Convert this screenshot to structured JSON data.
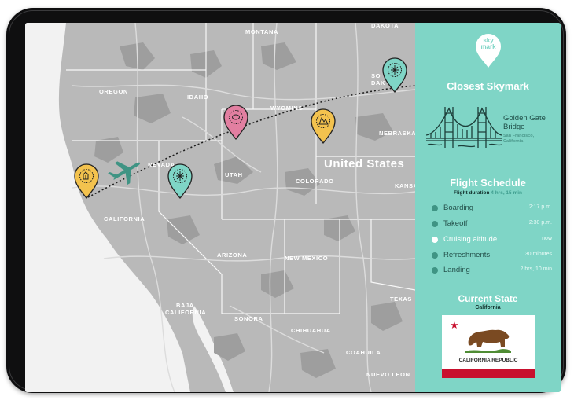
{
  "map": {
    "labels": {
      "montana": "MONTANA",
      "dakota": "DAKOTA",
      "oregon": "OREGON",
      "idaho": "IDAHO",
      "wyoming": "WYOMING",
      "nebraska": "NEBRASKA",
      "nevada": "NEVADA",
      "united_states": "United States",
      "utah": "UTAH",
      "colorado": "COLORADO",
      "kansas": "KANSA",
      "california": "CALIFORNIA",
      "arizona": "ARIZONA",
      "new_mexico": "NEW MEXICO",
      "texas": "TEXAS",
      "baja": "BAJA",
      "baja2": "CALIFORNIA",
      "sonora": "SONORA",
      "chihuahua": "CHIHUAHUA",
      "coahuila": "COAHUILA",
      "nuevo_leon": "NUEVO LEON",
      "south": "SO",
      "dakota2": "DAK"
    }
  },
  "panel": {
    "logo_line1": "sky",
    "logo_line2": "mark",
    "closest_title": "Closest Skymark",
    "bridge_name_line1": "Golden Gate",
    "bridge_name_line2": "Bridge",
    "bridge_location_line1": "San Francisco,",
    "bridge_location_line2": "California",
    "flight_title": "Flight Schedule",
    "flight_duration_label": "Flight duration",
    "flight_duration_value": "4 hrs, 15 min",
    "schedule": [
      {
        "name": "Boarding",
        "time": "2:17 p.m."
      },
      {
        "name": "Takeoff",
        "time": "2:30 p.m."
      },
      {
        "name": "Cruising altitude",
        "time": "now"
      },
      {
        "name": "Refreshments",
        "time": "30 minutes"
      },
      {
        "name": "Landing",
        "time": "2 hrs, 10 min"
      }
    ],
    "current_state_title": "Current State",
    "current_state": "California",
    "flag_text": "CALIFORNIA  REPUBLIC"
  },
  "colors": {
    "panel_bg": "#7fd5c6",
    "pin_yellow": "#f3c24e",
    "pin_teal": "#7fd5c6",
    "pin_pink": "#e27fa1",
    "plane": "#3f9484"
  }
}
